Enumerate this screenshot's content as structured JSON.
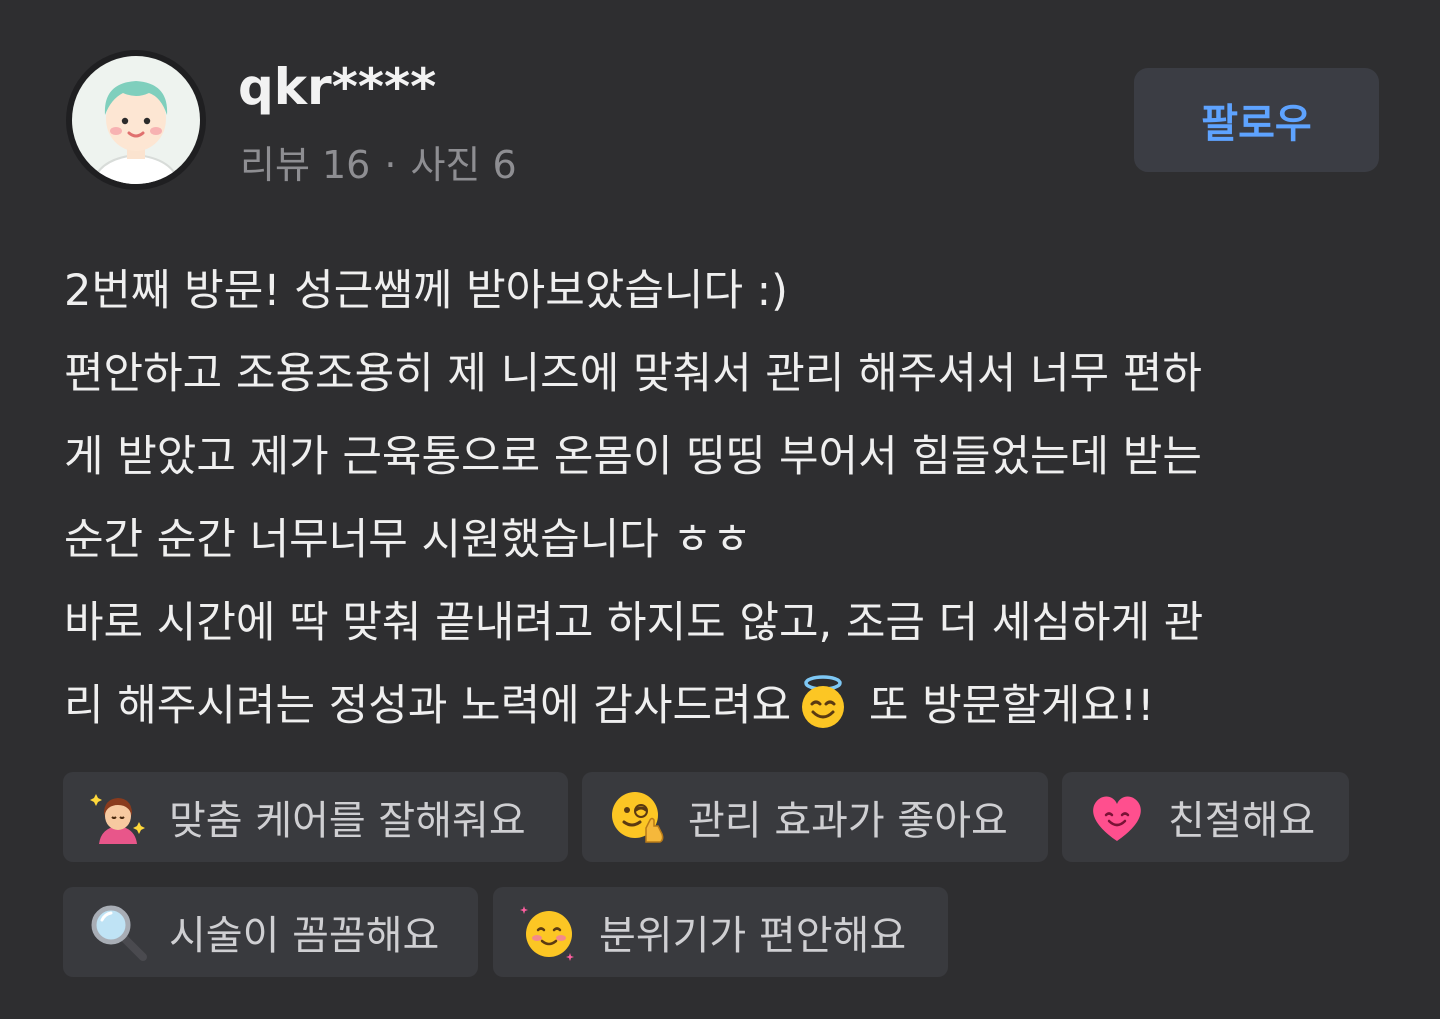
{
  "user": {
    "name": "qkr****",
    "review_count_label": "리뷰 16",
    "separator": "·",
    "photo_count_label": "사진 6"
  },
  "follow_button": {
    "label": "팔로우"
  },
  "review": {
    "lines": [
      "2번째 방문! 성근쌤께 받아보았습니다 :)",
      "편안하고 조용조용히 제 니즈에 맞춰서 관리 해주셔서 너무 편하",
      "게 받았고 제가 근육통으로 온몸이 띵띵 부어서 힘들었는데 받는",
      "순간 순간 너무너무 시원했습니다 ㅎㅎ",
      "바로 시간에 딱 맞춰 끝내려고 하지도 않고, 조금 더 세심하게 관",
      "리 해주시려는 정성과 노력에 감사드려요",
      "또 방문할게요!!"
    ]
  },
  "tags": [
    {
      "label": "맞춤 케어를 잘해줘요",
      "icon": "person-sparkle-icon"
    },
    {
      "label": "관리 효과가 좋아요",
      "icon": "wink-thumbs-up-icon"
    },
    {
      "label": "친절해요",
      "icon": "smiling-heart-icon"
    },
    {
      "label": "시술이 꼼꼼해요",
      "icon": "magnifier-icon"
    },
    {
      "label": "분위기가 편안해요",
      "icon": "blushing-face-icon"
    }
  ],
  "colors": {
    "background": "#2e2e30",
    "chip": "#393a3e",
    "follow_bg": "#3b3d44",
    "follow_text": "#5ea3ff",
    "muted_text": "#8e8e92"
  }
}
